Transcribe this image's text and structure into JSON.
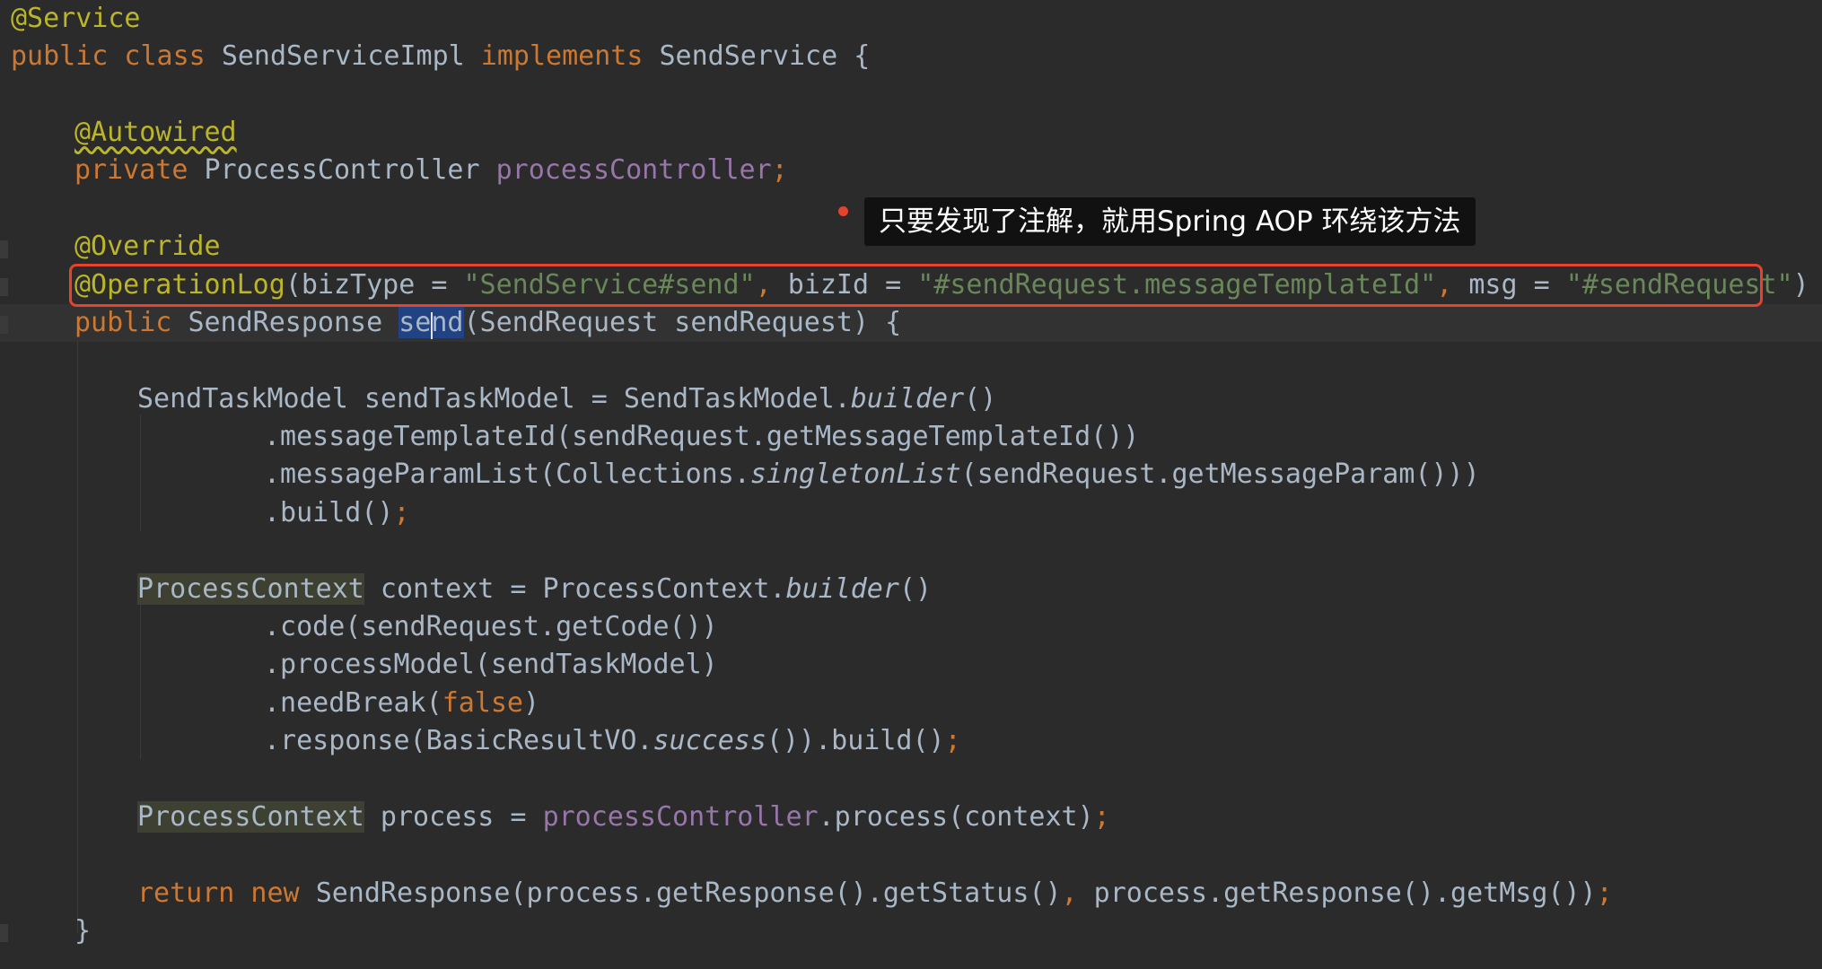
{
  "editor": {
    "language": "java",
    "theme": "darcula",
    "colors": {
      "background": "#2b2b2b",
      "keyword": "#cc7832",
      "annotation": "#bbb529",
      "field": "#9876aa",
      "string": "#6a8759",
      "plain": "#a9b7c6",
      "highlight_box": "#e5432c"
    },
    "code": {
      "l1_ann": "@Service",
      "l2_kw1": "public class ",
      "l2_cls": "SendServiceImpl ",
      "l2_kw2": "implements ",
      "l2_rest": "SendService {",
      "l4_ann": "@Autowired",
      "l5_kw": "private ",
      "l5_type": "ProcessController ",
      "l5_field": "processController",
      "l5_semi": ";",
      "l7_ann": "@Override",
      "l8_ann": "@OperationLog",
      "l8_p1": "(bizType = ",
      "l8_s1": "\"SendService#send\"",
      "l8_c1": ", ",
      "l8_p2": "bizId = ",
      "l8_s2": "\"#sendRequest.messageTemplateId\"",
      "l8_c2": ", ",
      "l8_p3": "msg = ",
      "l8_s3": "\"#sendRequest\"",
      "l8_end": ")",
      "l9_kw": "public ",
      "l9_type": "SendResponse ",
      "l9_m1": "se",
      "l9_m2": "nd",
      "l9_rest": "(SendRequest sendRequest) {",
      "l11_a": "SendTaskModel sendTaskModel = SendTaskModel.",
      "l11_it": "builder",
      "l11_b": "()",
      "l12": ".messageTemplateId(sendRequest.getMessageTemplateId())",
      "l13_a": ".messageParamList(Collections.",
      "l13_it": "singletonList",
      "l13_b": "(sendRequest.getMessageParam()))",
      "l14_a": ".build()",
      "l14_semi": ";",
      "l16_type": "ProcessContext",
      "l16_a": " context = ProcessContext.",
      "l16_it": "builder",
      "l16_b": "()",
      "l17": ".code(sendRequest.getCode())",
      "l18": ".processModel(sendTaskModel)",
      "l19_a": ".needBreak(",
      "l19_kw": "false",
      "l19_b": ")",
      "l20_a": ".response(BasicResultVO.",
      "l20_it": "success",
      "l20_b": "()).build()",
      "l20_semi": ";",
      "l22_type": "ProcessContext",
      "l22_a": " process = ",
      "l22_field": "processController",
      "l22_b": ".process(context)",
      "l22_semi": ";",
      "l24_kw": "return new ",
      "l24_a": "SendResponse(process.getResponse().getStatus()",
      "l24_c": ", ",
      "l24_b": "process.getResponse().getMsg())",
      "l24_semi": ";",
      "l25": "}"
    }
  },
  "annotation_callout": {
    "text": "只要发现了注解，就用Spring AOP 环绕该方法"
  }
}
